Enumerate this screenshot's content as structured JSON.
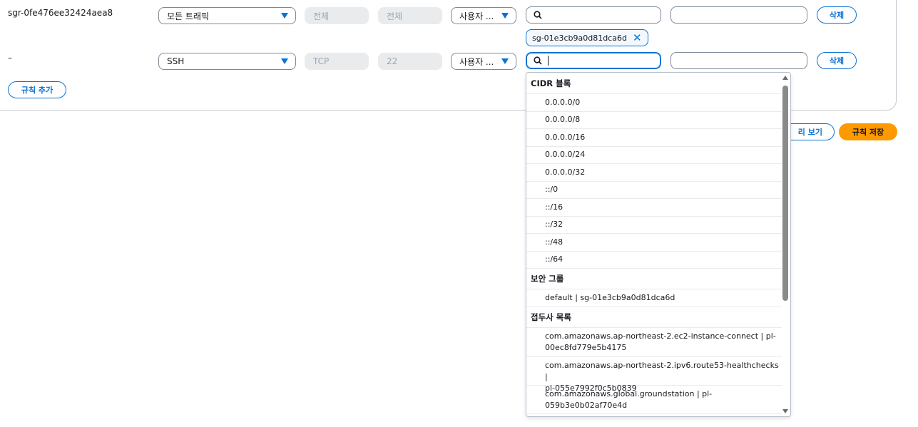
{
  "rules": [
    {
      "id": "sgr-0fe476ee32424aea8",
      "type": "모든 트래픽",
      "protocol": "전체",
      "port_range": "전체",
      "source_type": "사용자 ...",
      "source_search": "",
      "selected_token": "sg-01e3cb9a0d81dca6d",
      "description": "",
      "delete_label": "삭제"
    },
    {
      "id": "–",
      "type": "SSH",
      "protocol": "TCP",
      "port_range": "22",
      "source_type": "사용자 ...",
      "source_search": "",
      "description": "",
      "delete_label": "삭제"
    }
  ],
  "add_rule_label": "규칙 추가",
  "footer": {
    "preview_label": "리 보기",
    "save_label": "규칙 저장"
  },
  "dropdown": {
    "groups": [
      {
        "label": "CIDR 블록",
        "options": [
          "0.0.0.0/0",
          "0.0.0.0/8",
          "0.0.0.0/16",
          "0.0.0.0/24",
          "0.0.0.0/32",
          "::/0",
          "::/16",
          "::/32",
          "::/48",
          "::/64"
        ]
      },
      {
        "label": "보안 그룹",
        "options": [
          "default | sg-01e3cb9a0d81dca6d"
        ]
      },
      {
        "label": "접두사 목록",
        "options": [
          [
            "com.amazonaws.ap-northeast-2.ec2-instance-connect | pl-",
            "00ec8fd779e5b4175"
          ],
          [
            "com.amazonaws.ap-northeast-2.ipv6.route53-healthchecks |",
            "pl-055e7992f0c5b0839"
          ],
          [
            "com.amazonaws.global.groundstation | pl-",
            "059b3e0b02af70e4d"
          ]
        ]
      }
    ]
  },
  "colors": {
    "accent": "#0972d3",
    "primary_button": "#ff9900",
    "disabled_field": "#e9ebed"
  },
  "icons": {
    "search": "search-icon",
    "dropdown": "caret-down-icon",
    "remove": "close-icon"
  }
}
